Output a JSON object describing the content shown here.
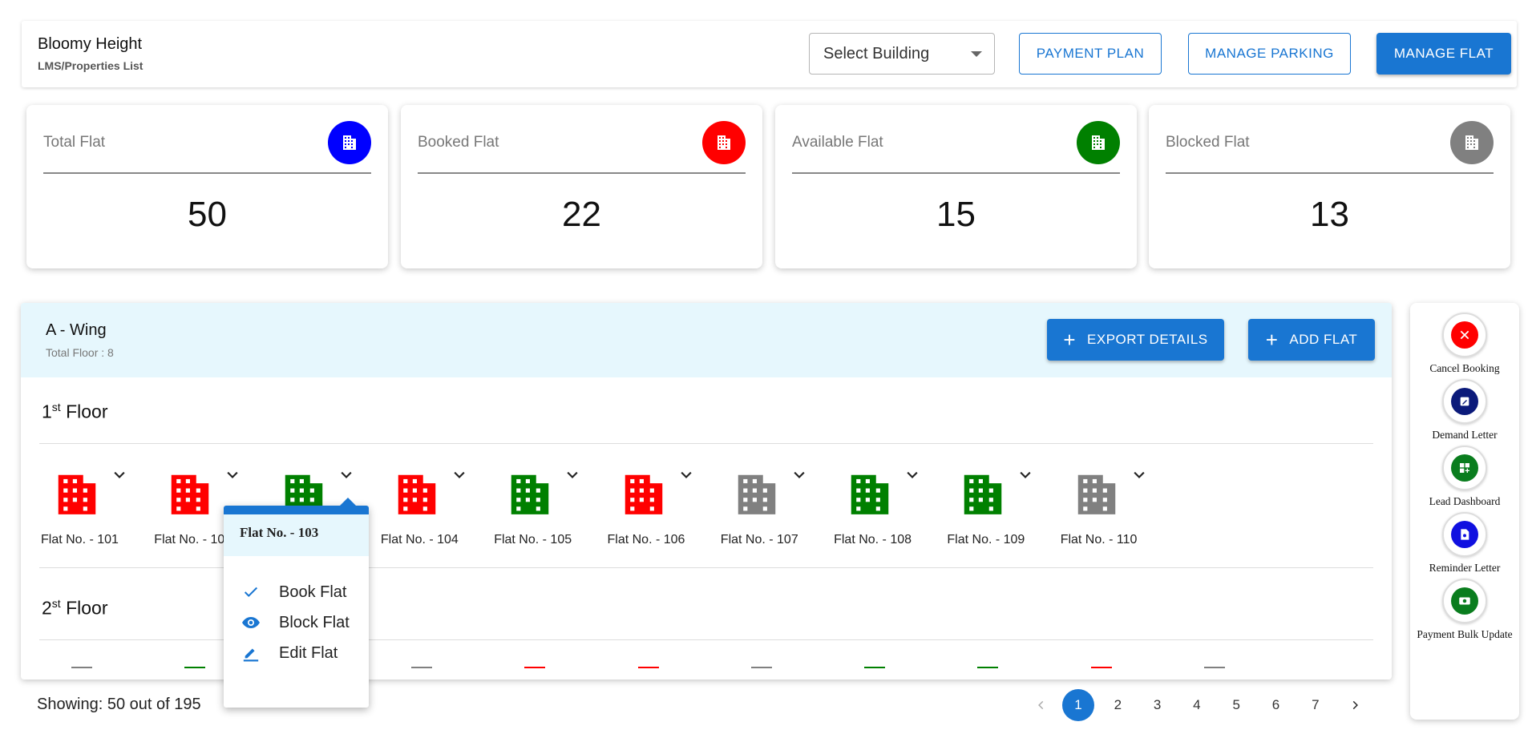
{
  "header": {
    "title": "Bloomy Height",
    "breadcrumb": "LMS/Properties List",
    "select_building": "Select Building",
    "payment_plan": "PAYMENT PLAN",
    "manage_parking": "MANAGE PARKING",
    "manage_flat": "MANAGE FLAT"
  },
  "stats": [
    {
      "label": "Total Flat",
      "value": "50",
      "color": "#0000ff"
    },
    {
      "label": "Booked Flat",
      "value": "22",
      "color": "#ff0000"
    },
    {
      "label": "Available Flat",
      "value": "15",
      "color": "#008000"
    },
    {
      "label": "Blocked Flat",
      "value": "13",
      "color": "#808080"
    }
  ],
  "wing": {
    "title": "A - Wing",
    "subtitle": "Total Floor : 8",
    "export_label": "EXPORT DETAILS",
    "add_label": "ADD FLAT",
    "floor1_num": "1",
    "floor1_sup": "st",
    "floor1_word": "Floor",
    "floor2_num": "2",
    "floor2_sup": "st",
    "floor2_word": "Floor"
  },
  "flats": [
    {
      "label": "Flat No. - 101",
      "status": "booked"
    },
    {
      "label": "Flat No. - 102",
      "status": "booked"
    },
    {
      "label": "Flat No. - 103",
      "status": "available"
    },
    {
      "label": "Flat No. - 104",
      "status": "booked"
    },
    {
      "label": "Flat No. - 105",
      "status": "available"
    },
    {
      "label": "Flat No. - 106",
      "status": "booked"
    },
    {
      "label": "Flat No. - 107",
      "status": "blocked"
    },
    {
      "label": "Flat No. - 108",
      "status": "available"
    },
    {
      "label": "Flat No. - 109",
      "status": "available"
    },
    {
      "label": "Flat No. - 110",
      "status": "blocked"
    }
  ],
  "floor2_flat_statuses": [
    "blocked",
    "available",
    "booked",
    "blocked",
    "booked",
    "booked",
    "blocked",
    "available",
    "available",
    "booked",
    "blocked"
  ],
  "status_colors": {
    "booked": "#ff0000",
    "available": "#008000",
    "blocked": "#808080",
    "accent": "#1976d2"
  },
  "popup": {
    "title": "Flat No. - 103",
    "book": "Book Flat",
    "block": "Block Flat",
    "edit": "Edit Flat"
  },
  "footer": {
    "showing": "Showing: 50 out of 195",
    "pages": [
      "1",
      "2",
      "3",
      "4",
      "5",
      "6",
      "7"
    ],
    "current_page": "1"
  },
  "actions": [
    {
      "label": "Cancel Booking",
      "icon": "close-icon",
      "color": "#ff0000"
    },
    {
      "label": "Demand Letter",
      "icon": "edit-note-icon",
      "color": "#0b1a7a"
    },
    {
      "label": "Lead Dashboard",
      "icon": "dashboard-add-icon",
      "color": "#0a7d1e"
    },
    {
      "label": "Reminder Letter",
      "icon": "document-icon",
      "color": "#1010e0"
    },
    {
      "label": "Payment Bulk Update",
      "icon": "payment-icon",
      "color": "#0a7d1e"
    }
  ]
}
